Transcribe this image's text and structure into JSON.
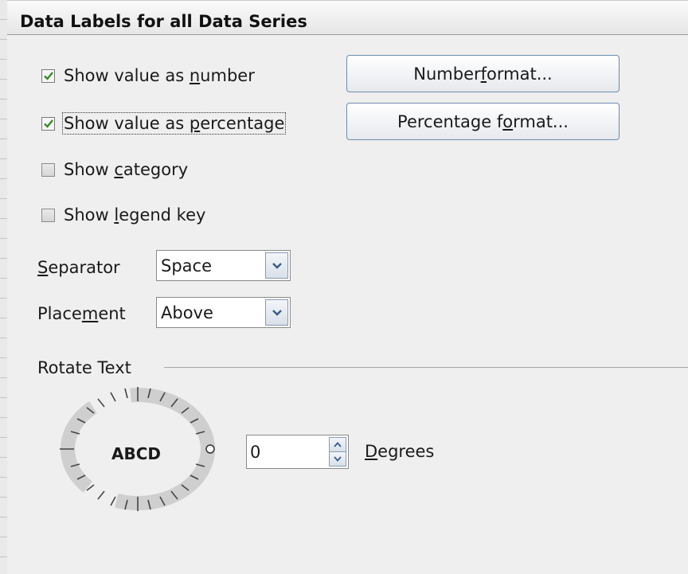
{
  "dialog": {
    "title": "Data Labels for all Data Series"
  },
  "options": {
    "show_number": {
      "label_pre": "Show value as ",
      "label_key": "n",
      "label_post": "umber",
      "checked": true
    },
    "show_percentage": {
      "label_pre": "Show value as ",
      "label_key": "p",
      "label_post": "ercentage",
      "checked": true
    },
    "show_category": {
      "label_pre": "Show ",
      "label_key": "c",
      "label_post": "ategory",
      "checked": false
    },
    "show_legend_key": {
      "label_pre": "Show ",
      "label_key": "l",
      "label_post": "egend key",
      "checked": false
    }
  },
  "buttons": {
    "number_format": {
      "pre": "Number ",
      "key": "f",
      "post": "ormat..."
    },
    "percentage_format": {
      "pre": "Percentage f",
      "key": "o",
      "post": "rmat..."
    }
  },
  "separator": {
    "label_key": "S",
    "label_post": "eparator",
    "value": "Space"
  },
  "placement": {
    "label_pre": "Place",
    "label_key": "m",
    "label_post": "ent",
    "value": "Above"
  },
  "rotate": {
    "section_label": "Rotate Text",
    "preview_text": "ABCD",
    "degrees_value": "0",
    "degrees_label_key": "D",
    "degrees_label_post": "egrees"
  },
  "colors": {
    "check": "#3a8a2a",
    "accent_border": "#6f8bac"
  },
  "icons": {
    "checkmark": "checkmark-icon",
    "dropdown": "chevron-down-icon",
    "spin_up": "chevron-up-icon",
    "spin_down": "chevron-down-icon"
  }
}
